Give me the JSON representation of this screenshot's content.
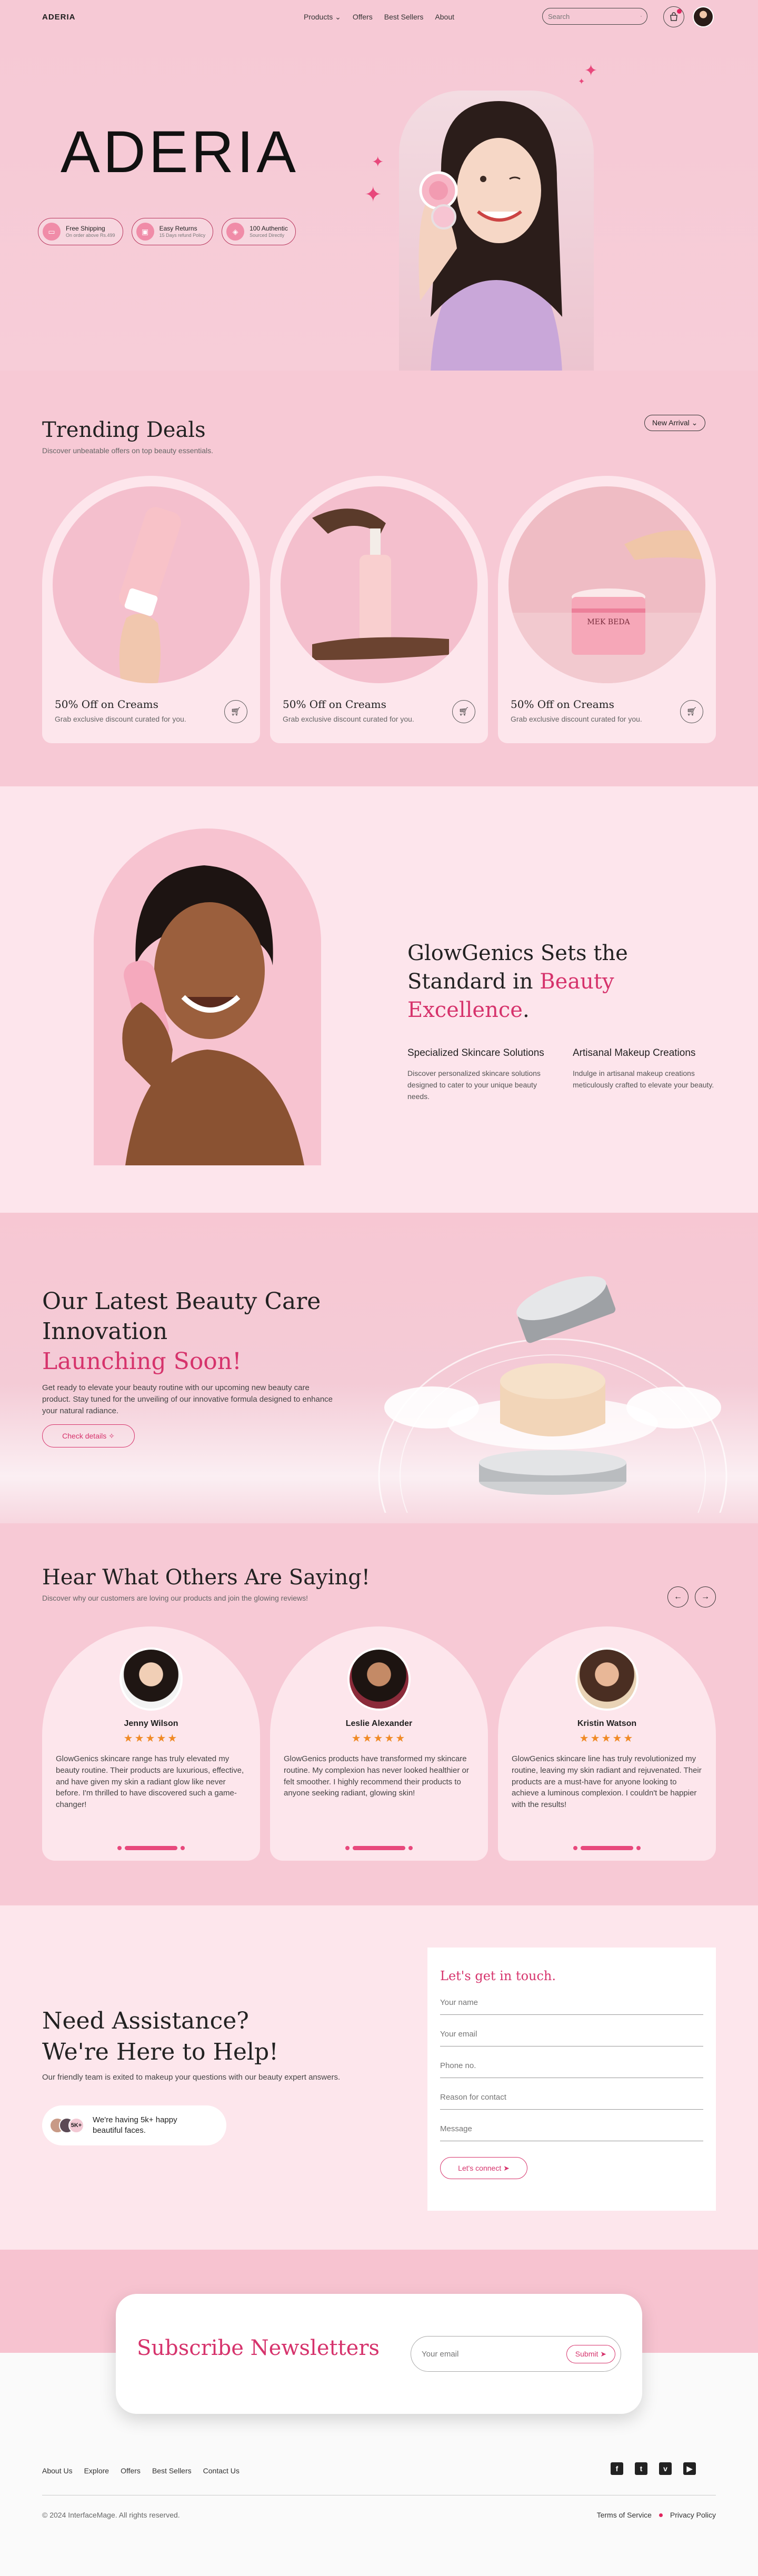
{
  "nav": {
    "logo": "ADERIA",
    "menu": [
      "Products",
      "Offers",
      "Best Sellers",
      "About"
    ],
    "search_placeholder": "Search"
  },
  "hero": {
    "brand": "ADERIA",
    "badges": [
      {
        "title": "Free Shipping",
        "sub": "On order above Rs.499",
        "icon": "truck-icon"
      },
      {
        "title": "Easy Returns",
        "sub": "15 Days refund Policy",
        "icon": "box-icon"
      },
      {
        "title": "100 Authentic",
        "sub": "Sourced Directly",
        "icon": "shield-icon"
      }
    ]
  },
  "trending": {
    "title": "Trending Deals",
    "sub": "Discover unbeatable offers on top beauty essentials.",
    "filter": "New Arrival",
    "cards": [
      {
        "title": "50% Off on Creams",
        "sub": "Grab exclusive discount curated for you."
      },
      {
        "title": "50% Off on Creams",
        "sub": "Grab exclusive discount curated for you."
      },
      {
        "title": "50% Off on Creams",
        "sub": "Grab exclusive discount curated for you."
      }
    ],
    "jar_label": "MEK BEDA"
  },
  "glow": {
    "heading_1": "GlowGenics Sets the",
    "heading_2": "Standard in ",
    "heading_accent_1": "Beauty",
    "heading_accent_2": "Excellence",
    "heading_end": ".",
    "features": [
      {
        "title": "Specialized Skincare Solutions",
        "text": "Discover personalized skincare solutions designed to cater to your unique beauty needs."
      },
      {
        "title": "Artisanal Makeup Creations",
        "text": "Indulge in artisanal makeup creations meticulously crafted to elevate your beauty."
      }
    ]
  },
  "launch": {
    "heading_1": "Our Latest Beauty Care",
    "heading_2": "Innovation",
    "heading_accent": "Launching Soon!",
    "text": "Get ready to elevate your beauty routine with our upcoming new beauty care product. Stay tuned for the unveiling of our innovative formula designed to enhance your natural radiance.",
    "button": "Check details"
  },
  "testimonials": {
    "title": "Hear What Others Are Saying!",
    "sub": "Discover why our customers are loving our products and join the glowing reviews!",
    "items": [
      {
        "name": "Jenny Wilson",
        "stars": "★★★★★",
        "text": "GlowGenics skincare range has truly elevated my beauty routine. Their products are luxurious, effective, and have given my skin a radiant glow like never before. I'm thrilled to have discovered such a game-changer!"
      },
      {
        "name": "Leslie Alexander",
        "stars": "★★★★★",
        "text": "GlowGenics products have transformed my skincare routine. My complexion has never looked healthier or felt smoother. I highly recommend their products to anyone seeking radiant, glowing skin!"
      },
      {
        "name": "Kristin Watson",
        "stars": "★★★★★",
        "text": "GlowGenics skincare line has truly revolutionized my routine, leaving my skin radiant and rejuvenated. Their products are a must-have for anyone looking to achieve a luminous complexion. I couldn't be happier with the results!"
      }
    ]
  },
  "contact": {
    "heading_1": "Need Assistance?",
    "heading_2": "We're Here to Help!",
    "sub": "Our friendly team is exited to makeup your questions with our beauty expert answers.",
    "happy_count": "5K+",
    "happy_text_1": "We're having 5k+ happy",
    "happy_text_2": "beautiful faces.",
    "form_title": "Let's get in touch.",
    "fields": [
      "Your name",
      "Your email",
      "Phone no.",
      "Reason for contact",
      "Message"
    ],
    "button": "Let's connect"
  },
  "subscribe": {
    "title": "Subscribe Newsletters",
    "placeholder": "Your email",
    "button": "Submit"
  },
  "footer": {
    "links": [
      "About Us",
      "Explore",
      "Offers",
      "Best Sellers",
      "Contact Us"
    ],
    "social": [
      "facebook-icon",
      "twitter-icon",
      "vimeo-icon",
      "youtube-icon"
    ],
    "social_glyphs": [
      "f",
      "t",
      "v",
      "▶"
    ],
    "copyright": "© 2024 InterfaceMage. All rights reserved.",
    "terms": "Terms of Service",
    "privacy": "Privacy Policy"
  },
  "colors": {
    "accent": "#d6336c",
    "bg_pink": "#f7c9d5",
    "bg_light": "#fde6ec"
  }
}
